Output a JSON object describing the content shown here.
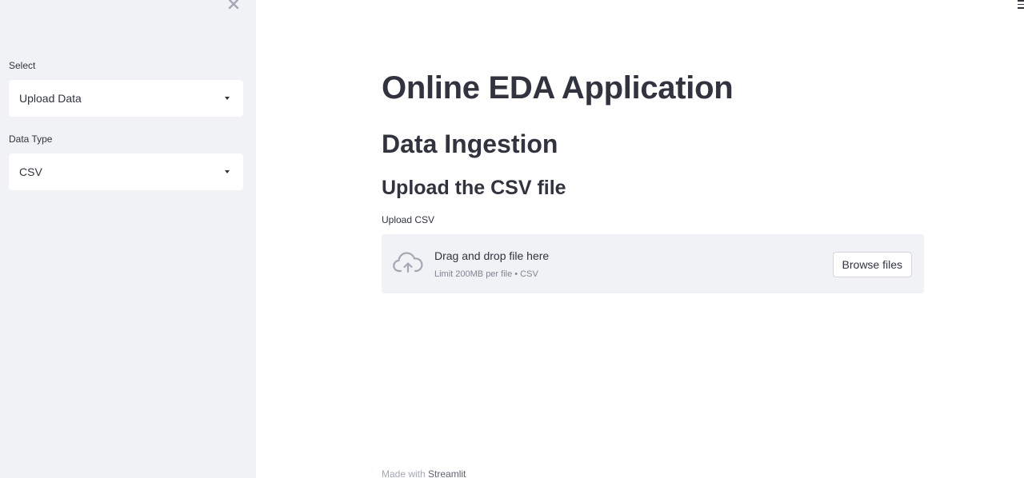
{
  "sidebar": {
    "close_icon": "close-icon",
    "fields": [
      {
        "label": "Select",
        "value": "Upload Data"
      },
      {
        "label": "Data Type",
        "value": "CSV"
      }
    ]
  },
  "header": {
    "menu_icon": "hamburger-menu-icon"
  },
  "main": {
    "title": "Online EDA Application",
    "subtitle": "Data Ingestion",
    "section_title": "Upload the CSV file",
    "uploader": {
      "label": "Upload CSV",
      "drop_text": "Drag and drop file here",
      "limit_text": "Limit 200MB per file • CSV",
      "browse_label": "Browse files",
      "icon": "cloud-upload-icon"
    }
  },
  "footer": {
    "prefix": "Made with ",
    "link": "Streamlit"
  },
  "colors": {
    "sidebar_bg": "#f0f2f6",
    "text": "#31333f",
    "icon": "#a3a8b4"
  }
}
